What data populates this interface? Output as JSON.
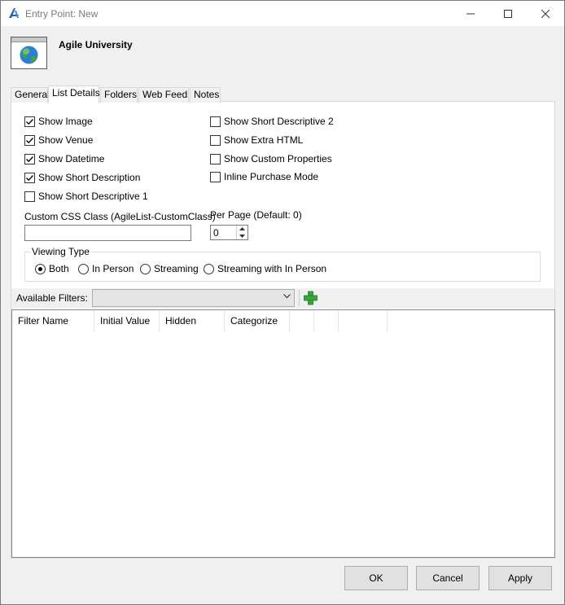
{
  "window": {
    "title": "Entry Point: New"
  },
  "header": {
    "title": "Agile University",
    "icon": "globe-window-icon"
  },
  "tabs": [
    {
      "label": "General",
      "active": false
    },
    {
      "label": "List Details",
      "active": true
    },
    {
      "label": "Folders",
      "active": false
    },
    {
      "label": "Web Feed",
      "active": false
    },
    {
      "label": "Notes",
      "active": false
    }
  ],
  "options_left": [
    {
      "label": "Show Image",
      "checked": true
    },
    {
      "label": "Show Venue",
      "checked": true
    },
    {
      "label": "Show Datetime",
      "checked": true
    },
    {
      "label": "Show Short Description",
      "checked": true
    },
    {
      "label": "Show Short Descriptive 1",
      "checked": false
    }
  ],
  "options_right": [
    {
      "label": "Show Short Descriptive 2",
      "checked": false
    },
    {
      "label": "Show Extra HTML",
      "checked": false
    },
    {
      "label": "Show Custom Properties",
      "checked": false
    },
    {
      "label": "Inline Purchase Mode",
      "checked": false
    }
  ],
  "css_class": {
    "label": "Custom CSS Class (AgileList-CustomClass)",
    "value": ""
  },
  "per_page": {
    "label": "Per Page (Default: 0)",
    "value": "0"
  },
  "viewing_type": {
    "label": "Viewing Type",
    "options": [
      {
        "label": "Both",
        "selected": true
      },
      {
        "label": "In Person",
        "selected": false
      },
      {
        "label": "Streaming",
        "selected": false
      },
      {
        "label": "Streaming with In Person",
        "selected": false
      }
    ]
  },
  "filters": {
    "label": "Available Filters:",
    "selected": "",
    "add_icon": "green-plus-icon"
  },
  "grid": {
    "columns": [
      "Filter Name",
      "Initial Value",
      "Hidden",
      "Categorize",
      "",
      "",
      ""
    ]
  },
  "buttons": {
    "ok": "OK",
    "cancel": "Cancel",
    "apply": "Apply"
  }
}
